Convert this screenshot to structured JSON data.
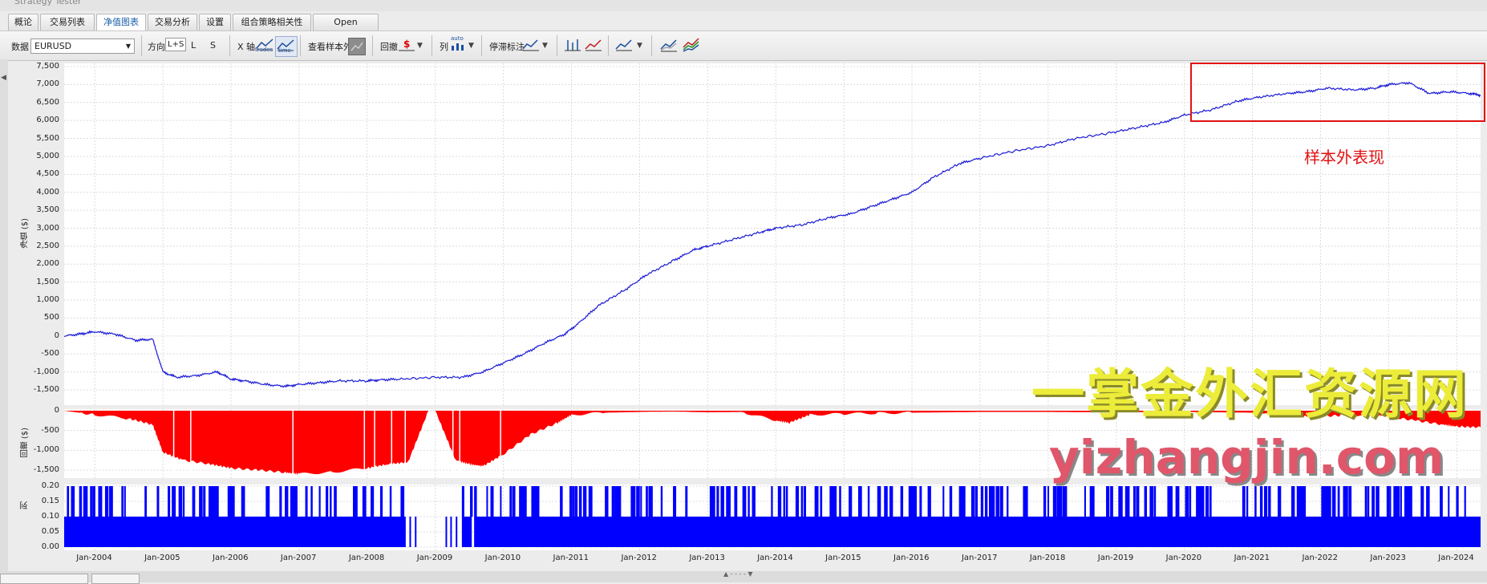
{
  "window": {
    "title": "Strategy Tester"
  },
  "tabs": [
    {
      "label": "概论"
    },
    {
      "label": "交易列表"
    },
    {
      "label": "净值图表",
      "active": true
    },
    {
      "label": "交易分析"
    },
    {
      "label": "设置"
    },
    {
      "label": "组合策略相关性"
    },
    {
      "label": "Open balances"
    }
  ],
  "toolbar": {
    "data_label": "数据",
    "data_value": "EURUSD",
    "direction_label": "方向",
    "dir_ls": "L+S",
    "dir_l": "L",
    "dir_s": "S",
    "xaxis_label": "X 轴",
    "xaxis_trades": "trades",
    "xaxis_time": "time",
    "oos_label": "查看样本外",
    "drawdown_label": "回撤",
    "column_label": "列",
    "column_auto": "auto",
    "stagnation_label": "停滞标注"
  },
  "annotation": {
    "text": "样本外表现",
    "color": "#e21212"
  },
  "watermark": {
    "line1": "一掌金外汇资源网",
    "line2": "yizhangjin.com"
  },
  "equity_panel": {
    "ylabel": "净值 ($)",
    "yticks": [
      "7,500",
      "7,000",
      "6,500",
      "6,000",
      "5,500",
      "5,000",
      "4,500",
      "4,000",
      "3,500",
      "3,000",
      "2,500",
      "2,000",
      "1,500",
      "1,000",
      "500",
      "0",
      "-500",
      "-1,000",
      "-1,500"
    ]
  },
  "drawdown_panel": {
    "ylabel": "回撤 ($)",
    "yticks": [
      "0",
      "-500",
      "-1,000",
      "-1,500"
    ]
  },
  "column_panel": {
    "ylabel": "列",
    "yticks": [
      "0.20",
      "0.15",
      "0.10",
      "0.05",
      "0.00"
    ]
  },
  "xaxis": {
    "ticks": [
      "Jan-2004",
      "Jan-2005",
      "Jan-2006",
      "Jan-2007",
      "Jan-2008",
      "Jan-2009",
      "Jan-2010",
      "Jan-2011",
      "Jan-2012",
      "Jan-2013",
      "Jan-2014",
      "Jan-2015",
      "Jan-2016",
      "Jan-2017",
      "Jan-2018",
      "Jan-2019",
      "Jan-2020",
      "Jan-2021",
      "Jan-2022",
      "Jan-2023",
      "Jan-2024"
    ]
  },
  "colors": {
    "equity": "#1a1ad6",
    "drawdown": "#ff0000",
    "columns": "#0000ff",
    "highlight_box": "#e21212"
  },
  "chart_data": {
    "type": "line",
    "x_unit": "year",
    "x": [
      2003.55,
      2003.8,
      2004.0,
      2004.3,
      2004.6,
      2004.85,
      2005.0,
      2005.2,
      2005.5,
      2005.8,
      2006.0,
      2006.2,
      2006.5,
      2006.8,
      2007.0,
      2007.3,
      2007.6,
      2008.0,
      2008.2,
      2008.5,
      2009.0,
      2009.4,
      2009.7,
      2010.0,
      2010.3,
      2010.6,
      2010.9,
      2011.1,
      2011.4,
      2011.8,
      2012.1,
      2012.5,
      2012.8,
      2013.0,
      2013.4,
      2013.8,
      2014.0,
      2014.4,
      2014.8,
      2015.1,
      2015.4,
      2015.7,
      2016.0,
      2016.3,
      2016.7,
      2017.0,
      2017.5,
      2018.0,
      2018.4,
      2018.9,
      2019.3,
      2019.7,
      2020.0,
      2020.4,
      2020.8,
      2021.1,
      2021.5,
      2021.8,
      2022.1,
      2022.5,
      2022.8,
      2023.0,
      2023.3,
      2023.6,
      2023.9,
      2024.2,
      2024.35
    ],
    "series": [
      {
        "values": [
          0,
          60,
          120,
          50,
          -120,
          -90,
          -1000,
          -1150,
          -1100,
          -1000,
          -1200,
          -1250,
          -1350,
          -1400,
          -1350,
          -1300,
          -1250,
          -1250,
          -1220,
          -1200,
          -1150,
          -1150,
          -1000,
          -750,
          -500,
          -200,
          50,
          350,
          850,
          1300,
          1700,
          2100,
          2400,
          2500,
          2700,
          2900,
          3000,
          3100,
          3300,
          3400,
          3600,
          3800,
          4000,
          4400,
          4800,
          4950,
          5150,
          5300,
          5500,
          5650,
          5800,
          5950,
          6150,
          6300,
          6550,
          6650,
          6750,
          6800,
          6900,
          6850,
          6900,
          7000,
          7050,
          6750,
          6800,
          6750,
          6700
        ]
      }
    ],
    "xlim": [
      2003.55,
      2024.35
    ],
    "ylim": [
      -1600,
      7500
    ],
    "subcharts": [
      {
        "type": "area",
        "ylabel": "回撤 ($)",
        "ylim": [
          -1700,
          0
        ],
        "x": [
          2003.55,
          2004.0,
          2004.5,
          2004.85,
          2005.0,
          2005.3,
          2005.7,
          2006.0,
          2006.4,
          2006.8,
          2007.0,
          2007.5,
          2008.0,
          2008.3,
          2008.6,
          2008.9,
          2009.0,
          2009.3,
          2009.5,
          2009.7,
          2010.0,
          2010.4,
          2010.8,
          2011.0,
          2011.5,
          2012.0,
          2012.5,
          2013.0,
          2013.5,
          2014.0,
          2014.2,
          2014.5,
          2015.0,
          2015.5,
          2016.0,
          2016.5,
          2017.0,
          2018.0,
          2019.0,
          2020.0,
          2021.0,
          2021.6,
          2021.9,
          2022.3,
          2022.8,
          2023.0,
          2023.4,
          2023.8,
          2024.0,
          2024.35
        ],
        "values": [
          0,
          -100,
          -200,
          -350,
          -1050,
          -1250,
          -1350,
          -1450,
          -1500,
          -1560,
          -1600,
          -1550,
          -1450,
          -1350,
          -1300,
          0,
          0,
          -1250,
          -1350,
          -1400,
          -1100,
          -600,
          -300,
          -100,
          -50,
          -30,
          -20,
          -40,
          -30,
          -250,
          -300,
          -100,
          -80,
          -60,
          -50,
          -40,
          -30,
          -30,
          -40,
          -30,
          -50,
          -120,
          -150,
          -120,
          -100,
          -150,
          -250,
          -350,
          -400,
          -420
        ]
      },
      {
        "type": "bar",
        "ylabel": "列",
        "ylim": [
          0,
          0.2
        ],
        "note": "trade count per period, values 0.10 or 0.20"
      }
    ]
  }
}
